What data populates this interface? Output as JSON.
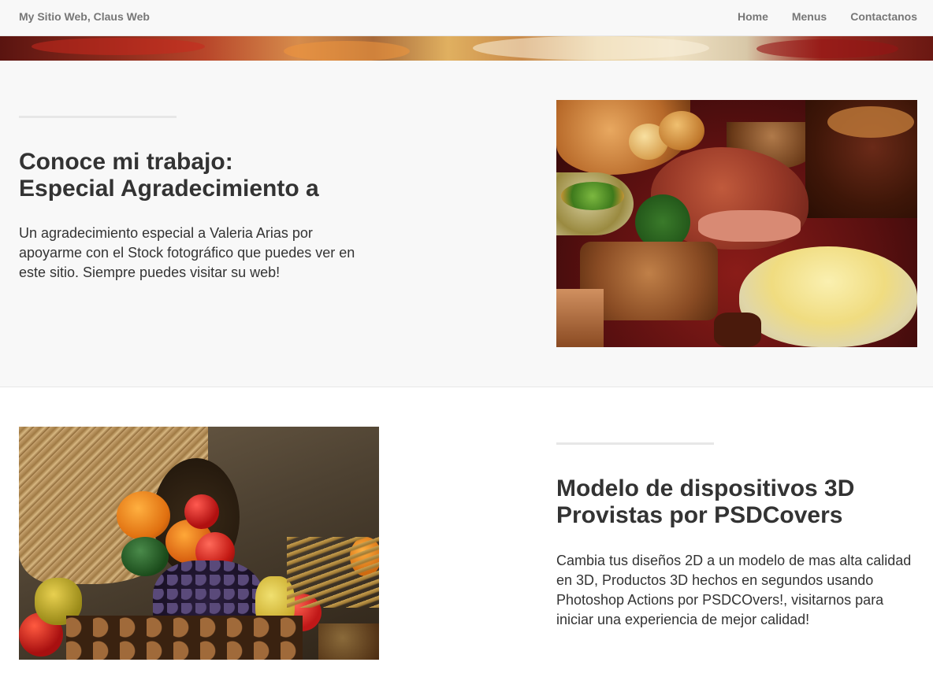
{
  "brand": "My Sitio Web, Claus Web",
  "nav": {
    "home": "Home",
    "menus": "Menus",
    "contact": "Contactanos"
  },
  "section1": {
    "heading_line1": "Conoce mi trabajo:",
    "heading_line2": "Especial Agradecimiento a",
    "text": "Un agradecimiento especial a Valeria Arias por apoyarme con el Stock fotográfico que puedes ver en este sitio. Siempre puedes visitar su web!"
  },
  "section2": {
    "heading_line1": "Modelo de dispositivos 3D",
    "heading_line2": "Provistas por PSDCovers",
    "text": "Cambia tus diseños 2D a un modelo de mas alta calidad en 3D, Productos 3D hechos en segundos usando Photoshop Actions por PSDCOvers!, visitarnos para iniciar una experiencia de mejor calidad!"
  },
  "colors": {
    "navbar_bg": "#f8f8f8",
    "nav_text": "#777777",
    "section_bg": "#f8f8f8",
    "text": "#333333",
    "divider": "#e7e7e7"
  }
}
